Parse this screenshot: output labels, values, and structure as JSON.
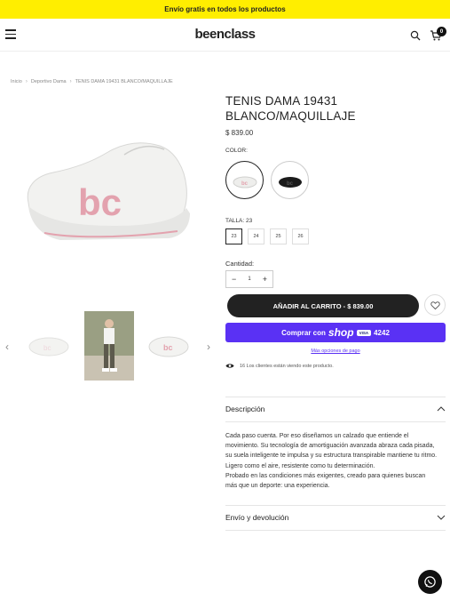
{
  "announcement": "Envío gratis en todos los productos",
  "header": {
    "logo": "beenclass",
    "cart_count": "0"
  },
  "breadcrumb": [
    "Inicio",
    "Deportivo Dama",
    "TENIS DAMA 19431 BLANCO/MAQUILLAJE"
  ],
  "product": {
    "title": "TENIS DAMA 19431 BLANCO/MAQUILLAJE",
    "price": "$ 839.00",
    "color_label": "COLOR:",
    "size_label": "TALLA: 23",
    "sizes": [
      "23",
      "24",
      "25",
      "26"
    ],
    "quantity_label": "Cantidad:",
    "quantity": "1",
    "add_to_cart": "AÑADIR AL CARRITO - $ 839.00",
    "shop_pay_prefix": "Comprar con",
    "shop_pay_brand": "shop",
    "shop_pay_card": "VISA",
    "shop_pay_digits": "4242",
    "more_payment": "Más opciones de pago",
    "viewers": "16 Los clientes están viendo este producto."
  },
  "description": {
    "heading": "Descripción",
    "p1": "Cada paso cuenta. Por eso diseñamos un calzado que entiende el movimiento. Su tecnología de amortiguación avanzada abraza cada pisada, su suela inteligente te impulsa y su estructura transpirable mantiene tu ritmo. Ligero como el aire, resistente como tu determinación.",
    "p2": "Probado en las condiciones más exigentes, creado para quienes buscan más que un deporte: una experiencia."
  },
  "shipping": {
    "heading": "Envío y devolución"
  },
  "colors": {
    "accent": "#ffee00",
    "shop_pay": "#5a31f4",
    "logo_pink": "#e3a2ae"
  }
}
